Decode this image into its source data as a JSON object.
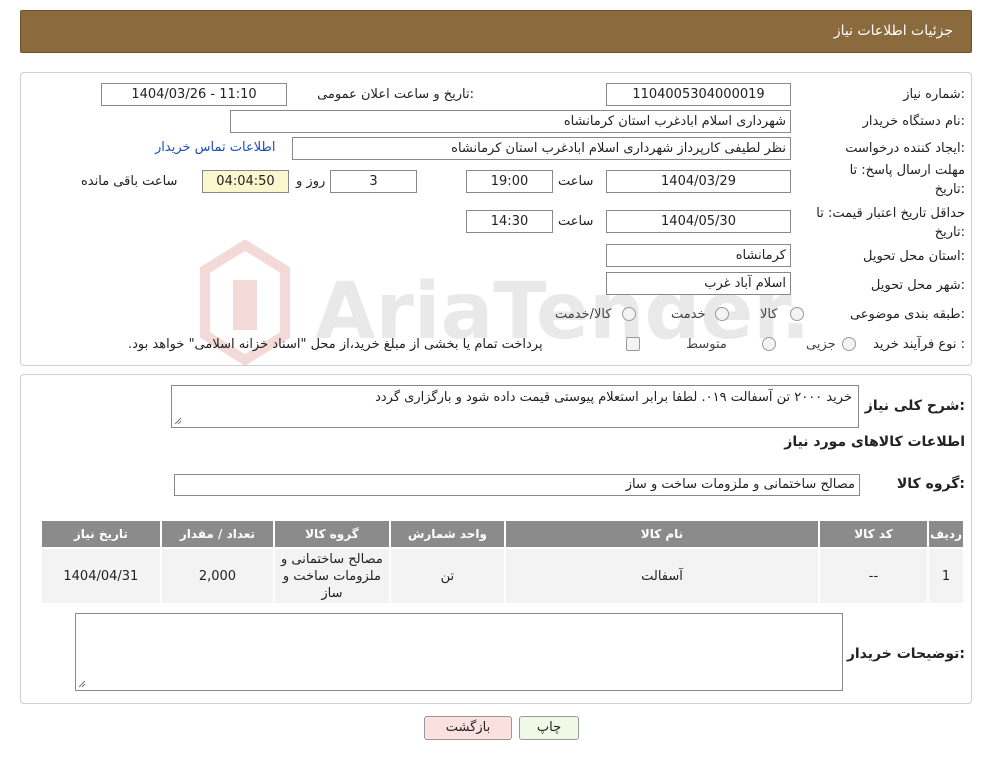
{
  "header": {
    "title": "جزئیات اطلاعات نیاز"
  },
  "fields": {
    "need_number_label": "شماره نیاز:",
    "need_number": "1104005304000019",
    "announce_label": "تاریخ و ساعت اعلان عمومی:",
    "announce_value": "1404/03/26 - 11:10",
    "buyer_org_label": "نام دستگاه خریدار:",
    "buyer_org": "شهرداری اسلام ابادغرب استان کرمانشاه",
    "creator_label": "ایجاد کننده درخواست:",
    "creator": "نظر لطیفی کارپرداز شهرداری اسلام ابادغرب استان کرمانشاه",
    "contact_link": "اطلاعات تماس خریدار",
    "deadline_label_1": "مهلت ارسال پاسخ: تا",
    "deadline_label_2": "تاریخ:",
    "deadline_date": "1404/03/29",
    "time_label": "ساعت",
    "deadline_time": "19:00",
    "days_value": "3",
    "days_label": "روز و",
    "remaining_value": "04:04:50",
    "remaining_label": "ساعت باقی مانده",
    "validity_label_1": "حداقل تاریخ اعتبار قیمت: تا",
    "validity_label_2": "تاریخ:",
    "validity_date": "1404/05/30",
    "validity_time": "14:30",
    "province_label": "استان محل تحویل:",
    "province": "کرمانشاه",
    "city_label": "شهر محل تحویل:",
    "city": "اسلام آباد غرب",
    "category_label": "طبقه بندی موضوعی:",
    "category_options": [
      "کالا",
      "خدمت",
      "کالا/خدمت"
    ],
    "process_label": "نوع فرآیند خرید :",
    "process_options": [
      "جزیی",
      "متوسط"
    ],
    "process_note": "پرداخت تمام یا بخشی از مبلغ خرید،از محل \"اسناد خزانه اسلامی\" خواهد بود."
  },
  "description": {
    "label": "شرح کلی نیاز:",
    "text": "خرید ۲۰۰۰ تن آسفالت ۰۱۹. لطفا برابر استعلام پیوستی قیمت داده شود و بارگزاری گردد"
  },
  "goods_section": {
    "title": "اطلاعات کالاهای مورد نیاز",
    "group_label": "گروه کالا:",
    "group_value": "مصالح ساختمانی و ملزومات ساخت و ساز"
  },
  "table": {
    "headers": [
      "ردیف",
      "کد کالا",
      "نام کالا",
      "واحد شمارش",
      "گروه کالا",
      "تعداد / مقدار",
      "تاریخ نیاز"
    ],
    "rows": [
      [
        "1",
        "--",
        "آسفالت",
        "تن",
        "مصالح ساختمانی و ملزومات ساخت و ساز",
        "2,000",
        "1404/04/31"
      ]
    ]
  },
  "buyer_notes": {
    "label": "توضیحات خریدار:",
    "text": ""
  },
  "buttons": {
    "print": "چاپ",
    "back": "بازگشت"
  },
  "watermark": {
    "text": "AriaTender.net"
  }
}
